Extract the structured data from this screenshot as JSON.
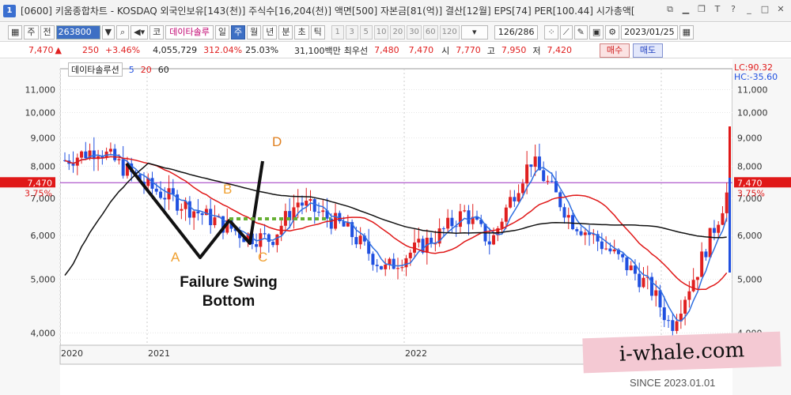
{
  "window": {
    "icon_text": "1",
    "title": "[0600] 키움종합차트 - KOSDAQ 외국인보유[143(천)] 주식수[16,204(천)] 액면[500] 자본금[81(억)] 결산[12월] EPS[74] PER[100.44] 시가총액["
  },
  "toolbar": {
    "period_select": "주",
    "jeon_label": "전",
    "code": "263800",
    "stock_name": "데이타솔루",
    "tabs": [
      "일",
      "주",
      "월",
      "년",
      "분",
      "초",
      "틱"
    ],
    "active_tab": "주",
    "nums": [
      "1",
      "3",
      "5",
      "10",
      "20",
      "30",
      "60",
      "120"
    ],
    "count": "126/286",
    "date": "2023/01/25",
    "ko_label": "코"
  },
  "info": {
    "price": "7,470",
    "change": "250",
    "change_pct": "+3.46%",
    "volume": "4,055,729",
    "vol_ratio": "312.04%",
    "turnover": "25.03%",
    "trade_value": "31,100백만",
    "best_ask_label": "최우선",
    "best_ask": "7,480",
    "best_bid": "7,470",
    "open_label": "시",
    "open": "7,770",
    "high_label": "고",
    "high": "7,950",
    "low_label": "저",
    "low": "7,420",
    "buy_label": "매수",
    "sell_label": "매도"
  },
  "legend": {
    "name": "데이타솔루션",
    "ma_periods": [
      "5",
      "20",
      "60"
    ]
  },
  "axis": {
    "right_top_lc": "LC:90.32",
    "right_top_hc": "HC:-35.60",
    "current_price_tag": "7,470",
    "current_pct_tag": "3.75%",
    "y_ticks": [
      "11,000",
      "10,000",
      "9,000",
      "8,000",
      "7,000",
      "6,000",
      "5,000",
      "4,000"
    ],
    "x_labels": [
      "2020",
      "2021",
      "2022"
    ]
  },
  "annotation": {
    "title_line1": "Failure Swing",
    "title_line2": "Bottom",
    "points": [
      "A",
      "B",
      "C",
      "D"
    ]
  },
  "watermark": {
    "brand": "i-whale.com",
    "since": "SINCE 2023.01.01"
  },
  "colors": {
    "up": "#e02020",
    "down": "#2050e0",
    "ma5": "#2f6fe0",
    "ma20": "#e01818",
    "ma60": "#111111",
    "price_line": "#9b30c0",
    "annotation": "#111111",
    "points": "#f0a030",
    "green_dotted": "#66b033"
  },
  "chart_data": {
    "type": "candlestick",
    "y_scale": "log",
    "ylim": [
      3800,
      12000
    ],
    "current_price": 7470,
    "y_ticks": [
      11000,
      10000,
      9000,
      8000,
      7000,
      6000,
      5000,
      4000
    ],
    "ma_periods": [
      5,
      20,
      60
    ]
  }
}
